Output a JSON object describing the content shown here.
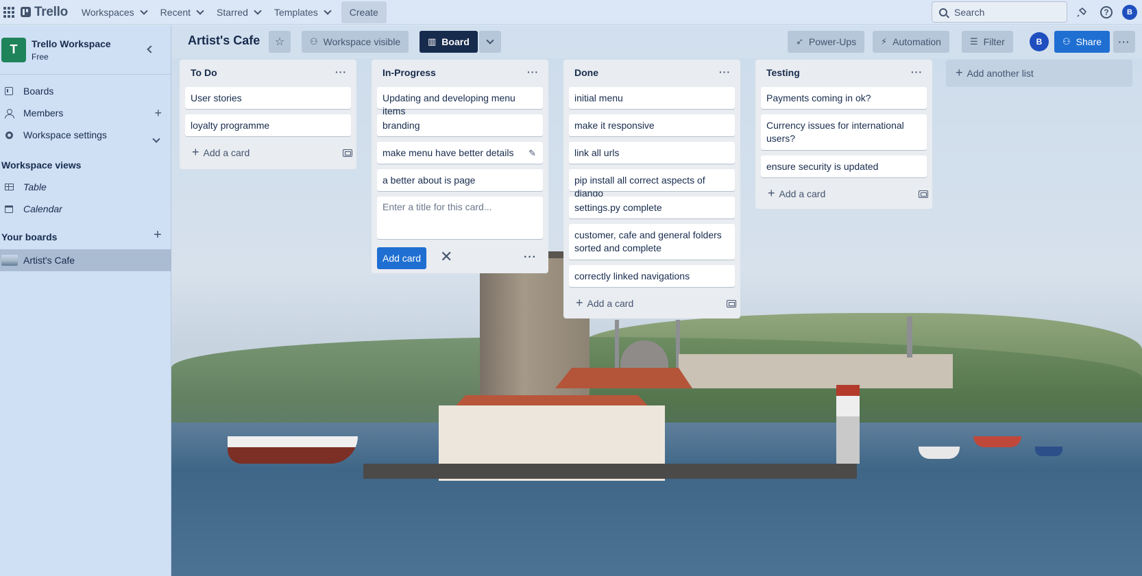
{
  "nav": {
    "logo": "Trello",
    "items": [
      "Workspaces",
      "Recent",
      "Starred",
      "Templates"
    ],
    "create": "Create",
    "search_placeholder": "Search",
    "avatar_initial": "B"
  },
  "sidebar": {
    "workspace_initial": "T",
    "workspace_name": "Trello Workspace",
    "workspace_plan": "Free",
    "items": {
      "boards": "Boards",
      "members": "Members",
      "settings": "Workspace settings"
    },
    "views_heading": "Workspace views",
    "views": {
      "table": "Table",
      "calendar": "Calendar"
    },
    "your_boards_heading": "Your boards",
    "boards": [
      "Artist's Cafe"
    ]
  },
  "board": {
    "title": "Artist's Cafe",
    "visibility": "Workspace visible",
    "view": "Board",
    "power_ups": "Power-Ups",
    "automation": "Automation",
    "filter": "Filter",
    "member_initial": "B",
    "share": "Share"
  },
  "lists": [
    {
      "title": "To Do",
      "cards": [
        "User stories",
        "loyalty programme"
      ],
      "add_card": "Add a card"
    },
    {
      "title": "In-Progress",
      "cards": [
        "Updating and developing menu items",
        "branding",
        "make menu have better details",
        "a better about is page"
      ],
      "composer_placeholder": "Enter a title for this card...",
      "add_card_button": "Add card"
    },
    {
      "title": "Done",
      "cards": [
        "initial menu",
        "make it responsive",
        "link all urls",
        "pip install all correct aspects of django",
        "settings.py complete",
        "customer, cafe and general folders sorted and complete",
        "correctly linked navigations"
      ],
      "add_card": "Add a card"
    },
    {
      "title": "Testing",
      "cards": [
        "Payments coming in ok?",
        "Currency issues for international users?",
        "ensure security is updated"
      ],
      "add_card": "Add a card"
    }
  ],
  "add_another_list": "Add another list"
}
